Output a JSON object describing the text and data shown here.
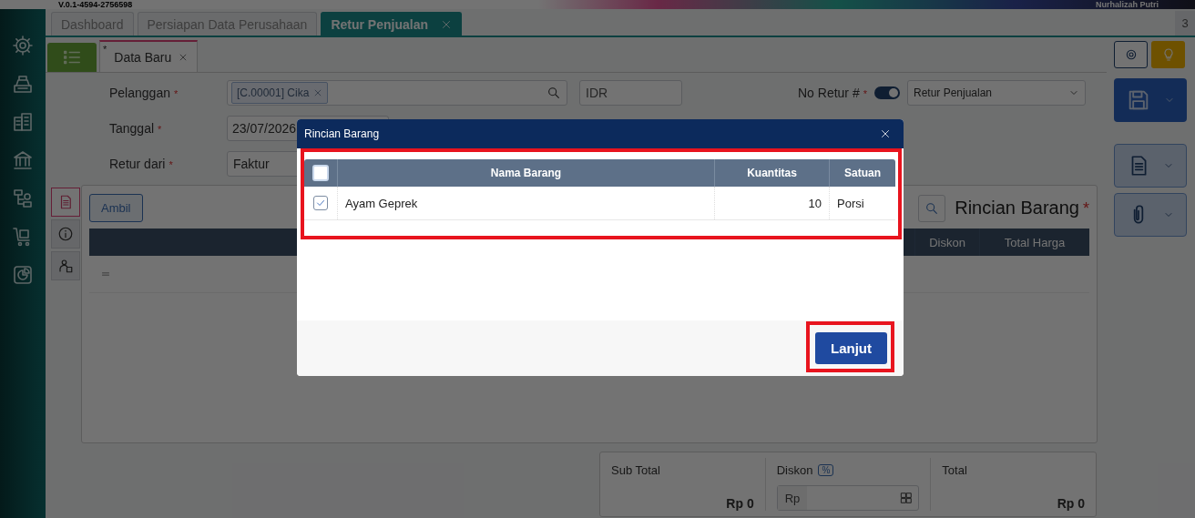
{
  "banner": {
    "version": "V.0.1-4594-2756598",
    "user": "Nurhalizah Putri"
  },
  "tabs": [
    {
      "label": "Dashboard",
      "selected": false,
      "closable": false
    },
    {
      "label": "Persiapan Data Perusahaan",
      "selected": false,
      "closable": false
    },
    {
      "label": "Retur Penjualan",
      "selected": true,
      "closable": true
    }
  ],
  "tab_count": "3",
  "doc_tab": {
    "marker": "*",
    "label": "Data Baru"
  },
  "form": {
    "customer": {
      "label": "Pelanggan",
      "required": true,
      "tag": "[C.00001] Cika",
      "currency": "IDR"
    },
    "date": {
      "label": "Tanggal",
      "required": true,
      "value": "23/07/2026"
    },
    "source": {
      "label": "Retur dari",
      "required": true,
      "value": "Faktur"
    },
    "number": {
      "label": "No Retur #",
      "required": true,
      "auto": true,
      "type": "Retur Penjualan"
    }
  },
  "side_tabs": [
    {
      "kind": "document",
      "selected": true
    },
    {
      "kind": "info",
      "selected": false
    },
    {
      "kind": "person",
      "selected": false
    }
  ],
  "items_panel": {
    "button": "Ambil",
    "title": "Rincian Barang",
    "required": true,
    "columns": [
      "Diskon",
      "Total Harga"
    ]
  },
  "totals": {
    "subtotal_label": "Sub Total",
    "subtotal": "Rp 0",
    "discount_label": "Diskon",
    "discount_unit": "%",
    "discount_prefix": "Rp",
    "total_label": "Total",
    "total": "Rp 0"
  },
  "modal": {
    "title": "Rincian Barang",
    "all_checked": false,
    "columns": [
      "Nama Barang",
      "Kuantitas",
      "Satuan"
    ],
    "rows": [
      {
        "checked": true,
        "name": "Ayam Geprek",
        "qty": "10",
        "unit": "Porsi"
      }
    ],
    "button": "Lanjut"
  }
}
